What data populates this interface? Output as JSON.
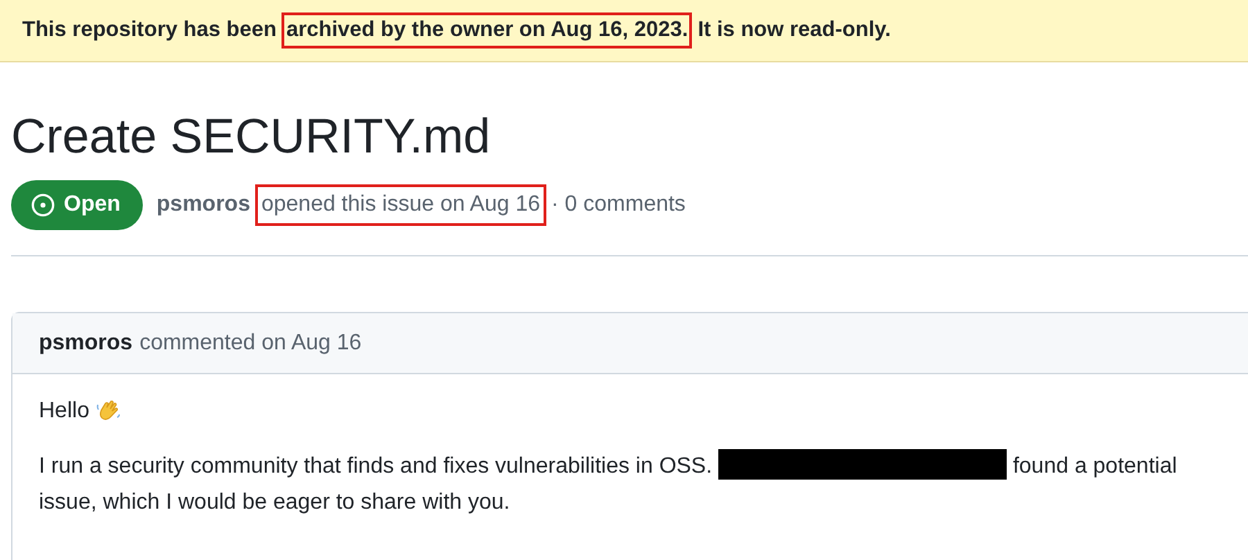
{
  "banner": {
    "segments": [
      {
        "text": "This repository has been",
        "highlighted": false
      },
      {
        "text": "archived by the owner on Aug 16, 2023.",
        "highlighted": true
      },
      {
        "text": "It is now read-only.",
        "highlighted": false
      }
    ]
  },
  "issue": {
    "title": "Create SECURITY.md",
    "status": {
      "label": "Open",
      "kind": "open"
    },
    "author": "psmoros",
    "meta": [
      {
        "text": "opened this issue on Aug 16",
        "highlighted": true
      },
      {
        "text": "· 0 comments",
        "highlighted": false
      }
    ]
  },
  "comment": {
    "author": "psmoros",
    "meta": "commented on Aug 16",
    "greeting": "Hello",
    "body": [
      {
        "kind": "text",
        "text": "I run a security community that finds and fixes vulnerabilities in OSS."
      },
      {
        "kind": "redaction"
      },
      {
        "kind": "text",
        "text": "found a potential"
      },
      {
        "kind": "break"
      },
      {
        "kind": "text",
        "text": "issue, which I would be eager to share with you."
      }
    ]
  }
}
